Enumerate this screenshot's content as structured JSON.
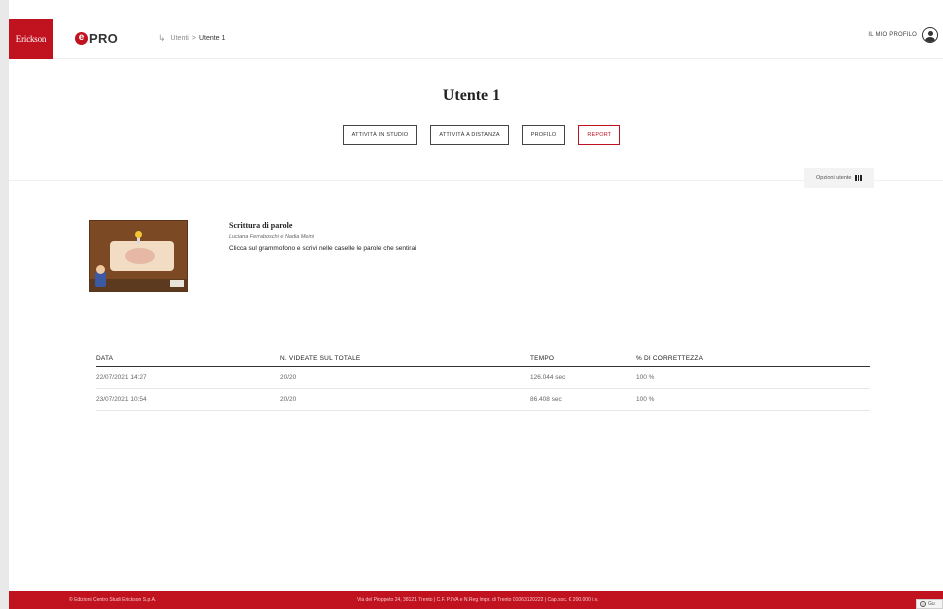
{
  "colors": {
    "brand_red": "#c1121f"
  },
  "header": {
    "brand_logo": "Erickson",
    "app_logo": {
      "e": "e",
      "rest": "PRO"
    },
    "breadcrumb": {
      "icon": "return-arrow-icon",
      "parent": "Utenti",
      "separator": ">",
      "current": "Utente 1"
    },
    "profile_label": "IL MIO PROFILO",
    "avatar_icon": "user-circle-icon"
  },
  "main": {
    "title": "Utente 1",
    "tabs": [
      {
        "label": "ATTIVITÀ IN STUDIO",
        "active": false
      },
      {
        "label": "ATTIVITÀ A DISTANZA",
        "active": false
      },
      {
        "label": "PROFILO",
        "active": false
      },
      {
        "label": "REPORT",
        "active": true
      }
    ],
    "options_button": {
      "label": "Opzioni utente",
      "icon": "columns-icon"
    }
  },
  "activity": {
    "title": "Scrittura di parole",
    "authors": "Luciana Ferraboschi e Nadia Meini",
    "description": "Clicca sul grammofono e scrivi nelle caselle le parole che sentirai"
  },
  "table": {
    "headers": [
      "DATA",
      "N. VIDEATE SUL TOTALE",
      "TEMPO",
      "% DI CORRETTEZZA"
    ],
    "rows": [
      [
        "22/07/2021 14:27",
        "20/20",
        "126.044 sec",
        "100 %"
      ],
      [
        "23/07/2021 10:54",
        "20/20",
        "86.408 sec",
        "100 %"
      ]
    ]
  },
  "footer": {
    "copyright": "© Edizioni Centro Studi Erickson S.p.A.",
    "address": "Via del Pioppeto 24, 38121 Trento | C.F. P.IVA e N.Reg Impr. di Trento 01063120222 | Cap.soc. € 200.000 i.v.",
    "guide_label": "Gu",
    "guide_icon": "help-circle-icon"
  }
}
